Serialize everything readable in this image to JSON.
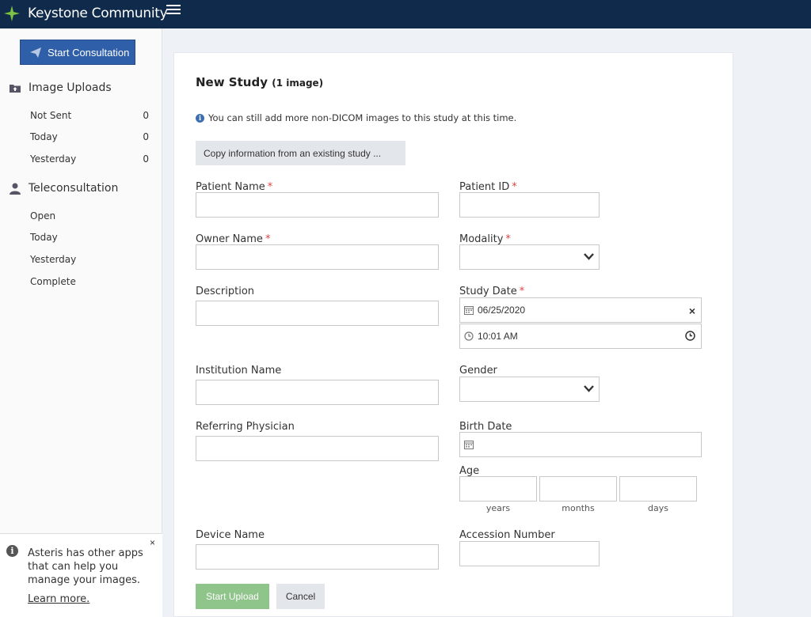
{
  "app": {
    "title": "Keystone Community"
  },
  "sidebar": {
    "start_consultation": "Start Consultation",
    "uploads": {
      "title": "Image Uploads",
      "items": [
        {
          "label": "Not Sent",
          "count": "0"
        },
        {
          "label": "Today",
          "count": "0"
        },
        {
          "label": "Yesterday",
          "count": "0"
        }
      ]
    },
    "teleconsultation": {
      "title": "Teleconsultation",
      "items": [
        {
          "label": "Open"
        },
        {
          "label": "Today"
        },
        {
          "label": "Yesterday"
        },
        {
          "label": "Complete"
        }
      ]
    },
    "notice": {
      "message": "Asteris has other apps that can help you manage your images.",
      "link": "Learn more.",
      "close": "×"
    }
  },
  "form": {
    "title": "New Study",
    "title_count": "(1 image)",
    "hint": "You can still add more non-DICOM images to this study at this time.",
    "copy_button": "Copy information from an existing study ...",
    "required_mark": "*",
    "fields": {
      "patient_name": "Patient Name",
      "patient_id": "Patient ID",
      "owner_name": "Owner Name",
      "modality": "Modality",
      "description": "Description",
      "study_date": "Study Date",
      "institution_name": "Institution Name",
      "gender": "Gender",
      "referring_physician": "Referring Physician",
      "birth_date": "Birth Date",
      "age": "Age",
      "device_name": "Device Name",
      "accession_number": "Accession Number"
    },
    "values": {
      "study_date": "06/25/2020",
      "study_time": "10:01 AM"
    },
    "age_units": [
      "years",
      "months",
      "days"
    ],
    "clear_mark": "×",
    "buttons": {
      "upload": "Start Upload",
      "cancel": "Cancel"
    }
  },
  "icons": {
    "logo": "keystone-logo-icon",
    "menu": "hamburger-menu-icon",
    "send": "paper-plane-icon",
    "folder": "folder-upload-icon",
    "doctor": "doctor-user-icon",
    "calendar": "calendar-icon",
    "clock": "clock-icon",
    "chevron": "chevron-down-icon",
    "info": "info-icon"
  },
  "colors": {
    "topbar": "#0f2a4a",
    "primary": "#2f5fa8",
    "upload": "#8fc48a",
    "required": "#d44"
  }
}
